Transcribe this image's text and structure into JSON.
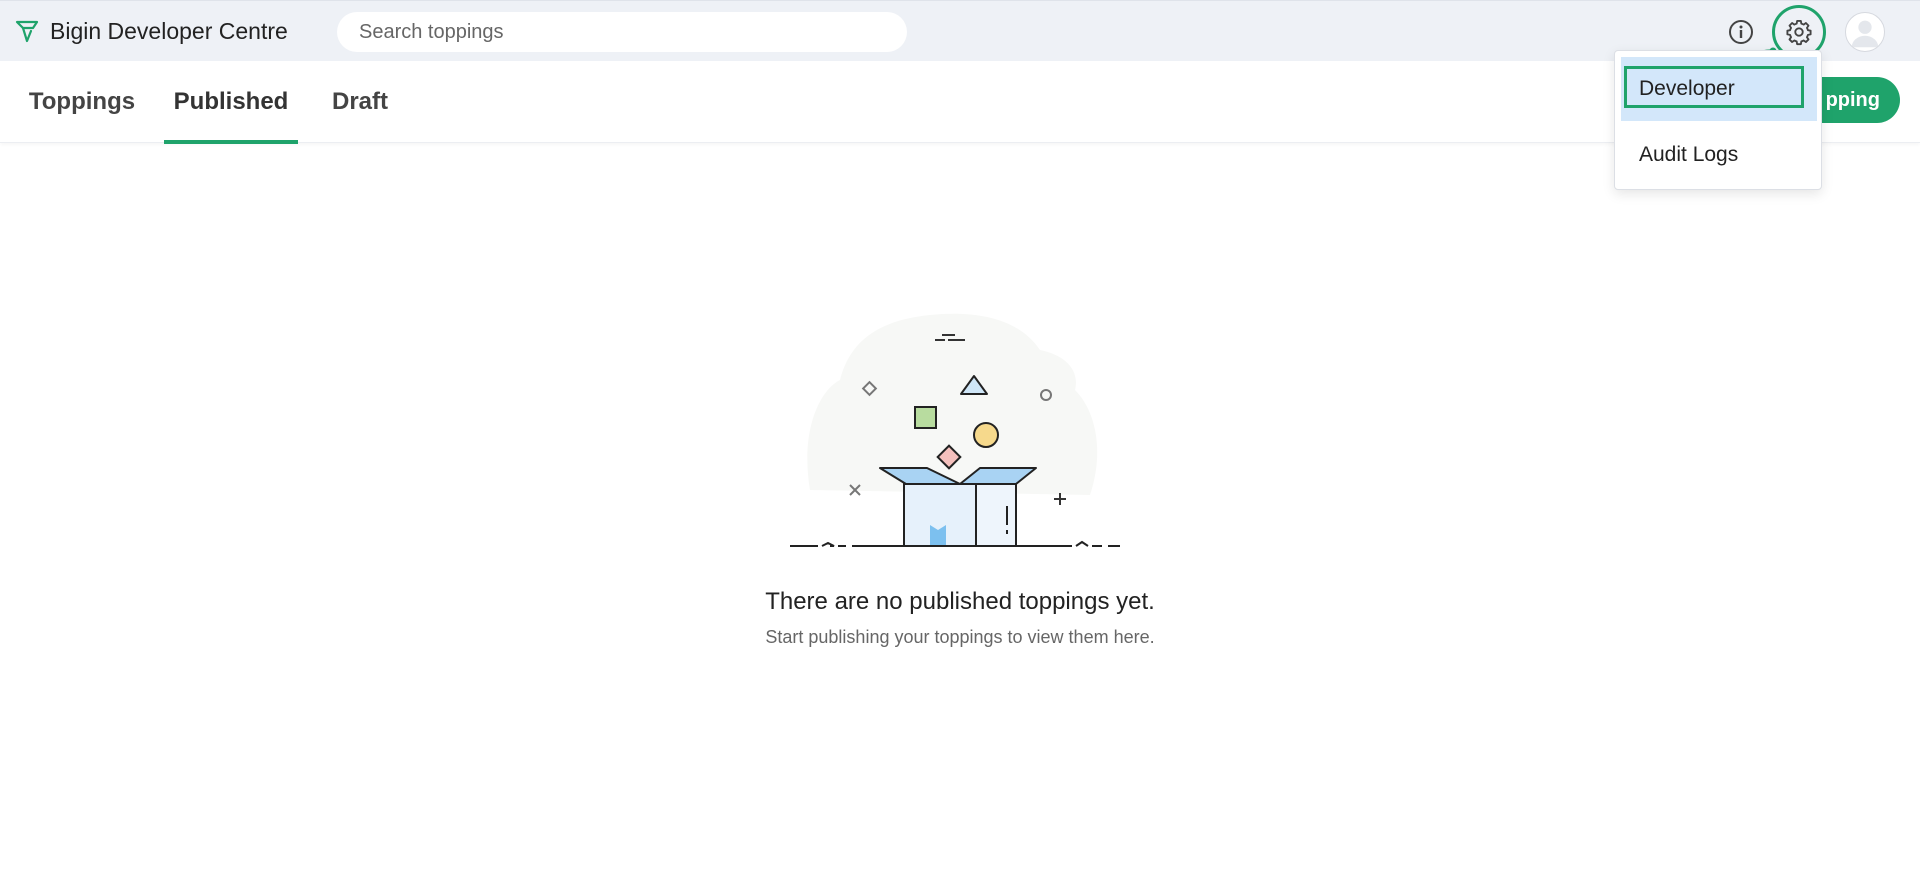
{
  "app": {
    "title": "Bigin Developer Centre",
    "brand_color": "#1fa36b"
  },
  "search": {
    "placeholder": "Search toppings",
    "value": ""
  },
  "header": {
    "icons": [
      "info-icon",
      "gear-icon",
      "avatar-icon"
    ]
  },
  "tabs": [
    {
      "label": "Toppings",
      "active": false
    },
    {
      "label": "Published",
      "active": true
    },
    {
      "label": "Draft",
      "active": false
    }
  ],
  "actions": {
    "create_label": "pping"
  },
  "settings_menu": {
    "items": [
      {
        "label": "Developer",
        "selected": true
      },
      {
        "label": "Audit Logs",
        "selected": false
      }
    ]
  },
  "empty_state": {
    "title": "There are no published toppings yet.",
    "subtitle": "Start publishing your toppings to view them here."
  },
  "colors": {
    "accent": "#1fa36b",
    "topbar_bg": "#eef1f6",
    "selected_menu_bg": "#d3e7fa"
  }
}
